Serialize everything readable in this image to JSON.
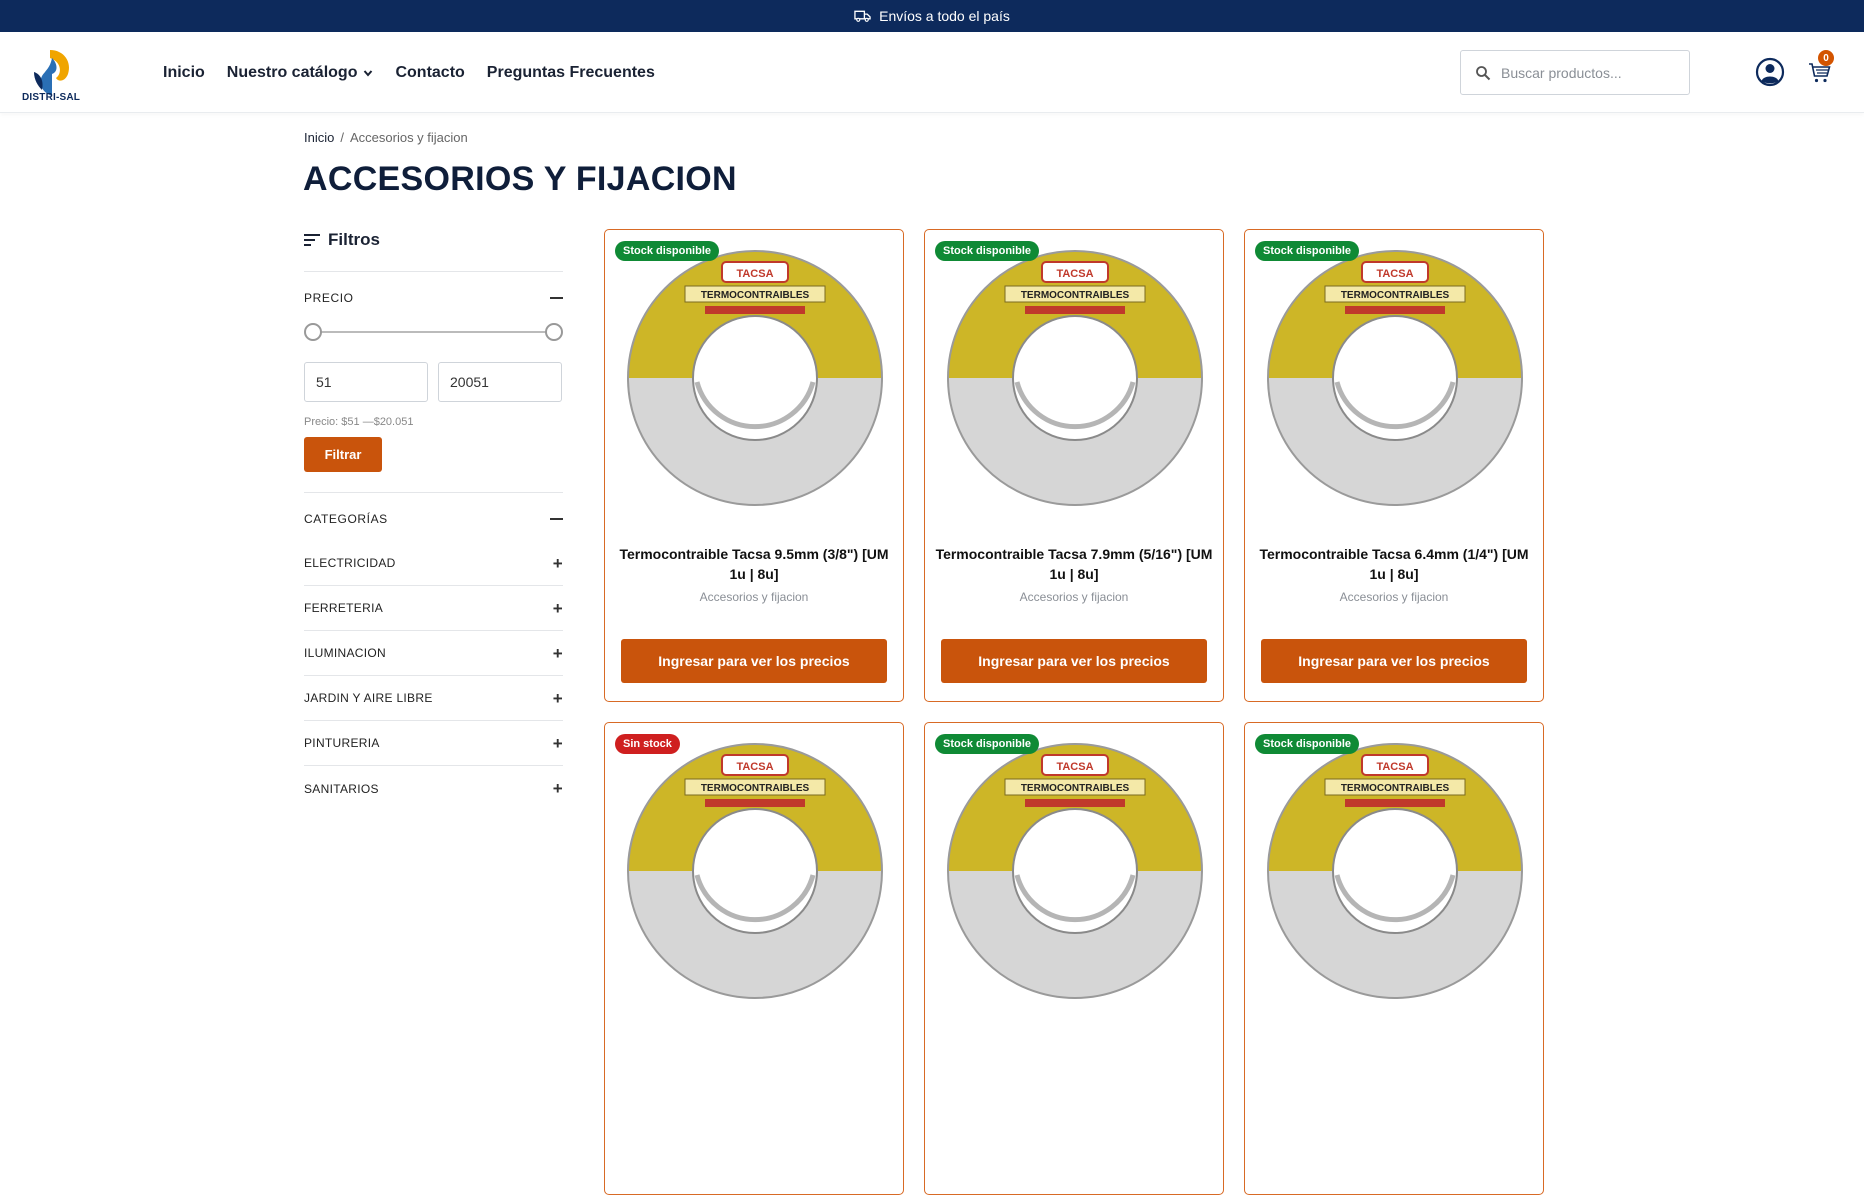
{
  "topbar": {
    "text": "Envíos a todo el país",
    "icon": "truck-icon"
  },
  "header": {
    "logo_text": "DISTRI-SAL",
    "nav": [
      "Inicio",
      "Nuestro catálogo",
      "Contacto",
      "Preguntas Frecuentes"
    ],
    "search_placeholder": "Buscar productos...",
    "cart_count": "0"
  },
  "breadcrumb": {
    "home": "Inicio",
    "separator": "/",
    "current": "Accesorios y fijacion"
  },
  "page_title": "ACCESORIOS Y FIJACION",
  "filters": {
    "title": "Filtros",
    "price": {
      "heading": "PRECIO",
      "min": "51",
      "max": "20051",
      "label": "Precio: $51 —$20.051",
      "button": "Filtrar"
    },
    "categories_heading": "CATEGORÍAS",
    "categories": [
      "ELECTRICIDAD",
      "FERRETERIA",
      "ILUMINACION",
      "JARDIN Y AIRE LIBRE",
      "PINTURERIA",
      "SANITARIOS"
    ]
  },
  "products": [
    {
      "badge": "Stock disponible",
      "stock": "in",
      "title": "Termocontraible Tacsa 9.5mm (3/8\") [UM 1u | 8u]",
      "category": "Accesorios y fijacion",
      "button": "Ingresar para ver los precios"
    },
    {
      "badge": "Stock disponible",
      "stock": "in",
      "title": "Termocontraible Tacsa 7.9mm (5/16\") [UM 1u | 8u]",
      "category": "Accesorios y fijacion",
      "button": "Ingresar para ver los precios"
    },
    {
      "badge": "Stock disponible",
      "stock": "in",
      "title": "Termocontraible Tacsa 6.4mm (1/4\") [UM 1u | 8u]",
      "category": "Accesorios y fijacion",
      "button": "Ingresar para ver los precios"
    },
    {
      "badge": "Sin stock",
      "stock": "out",
      "title": "",
      "category": "",
      "button": ""
    },
    {
      "badge": "Stock disponible",
      "stock": "in",
      "title": "",
      "category": "",
      "button": ""
    },
    {
      "badge": "Stock disponible",
      "stock": "in",
      "title": "",
      "category": "",
      "button": ""
    }
  ],
  "product_image_brand": "TACSA",
  "product_image_label": "TERMOCONTRAIBLES",
  "colors": {
    "accent": "#c9540c",
    "topbar": "#0d2a5c",
    "in_stock": "#0f8a35",
    "out_of_stock": "#cf1f1f"
  }
}
